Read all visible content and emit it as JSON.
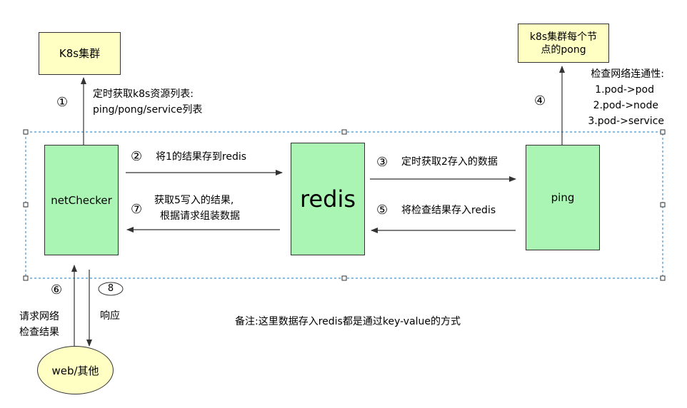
{
  "nodes": {
    "k8s_cluster": "K8s集群",
    "k8s_pong_line1": "k8s集群每个节",
    "k8s_pong_line2": "点的pong",
    "netchecker": "netChecker",
    "redis": "redis",
    "ping": "ping",
    "client": "web/其他"
  },
  "steps": {
    "s1": "①",
    "s2": "②",
    "s3": "③",
    "s4": "④",
    "s5": "⑤",
    "s6": "⑥",
    "s7": "⑦",
    "s8": "8"
  },
  "labels": {
    "s1_line1": "定时获取k8s资源列表:",
    "s1_line2": "ping/pong/service列表",
    "s2": "将1的结果存到redis",
    "s3": "定时获取2存入的数据",
    "s4_line1": "检查网络连通性:",
    "s4_line2": "1.pod->pod",
    "s4_line3": "2.pod->node",
    "s4_line4": "3.pod->service",
    "s5": "将检查结果存入redis",
    "s6_line1": "请求网络",
    "s6_line2": "检查结果",
    "s7_line1": "获取5写入的结果,",
    "s7_line2": "根据请求组装数据",
    "s8": "响应"
  },
  "note": "备注:这里数据存入redis都是通过key-value的方式"
}
